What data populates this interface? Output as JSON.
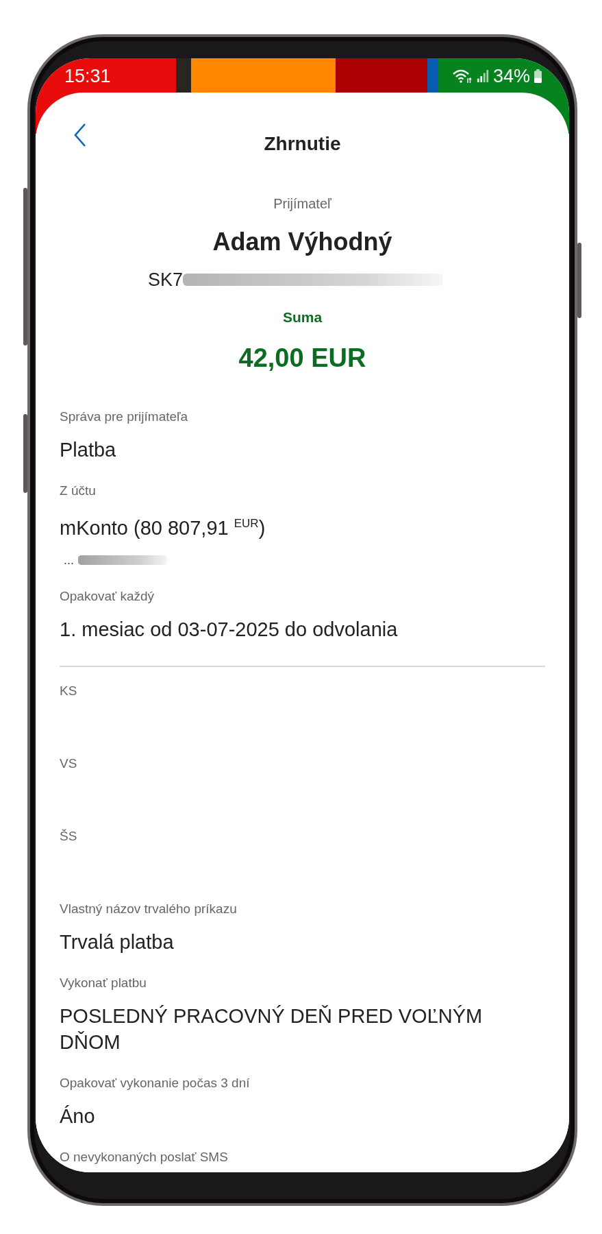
{
  "status_bar": {
    "time": "15:31",
    "battery": "34%"
  },
  "header": {
    "title": "Zhrnutie"
  },
  "recipient": {
    "label": "Prijímateľ",
    "name": "Adam Výhodný",
    "iban": "SK7"
  },
  "amount": {
    "label": "Suma",
    "value": "42,00 EUR"
  },
  "details": [
    {
      "kind": "text",
      "label": "Správa pre prijímateľa",
      "value": "Platba"
    },
    {
      "kind": "account",
      "label": "Z účtu",
      "value": "mKonto (80 807,91 $^{EUR}$)",
      "number": "..."
    },
    {
      "kind": "text",
      "label": "Opakovať každý",
      "value": "1. mesiac od 03-07-2025 do odvolania"
    }
  ],
  "symbols": [
    {
      "label": "KS"
    },
    {
      "label": "VS"
    },
    {
      "label": "ŠS"
    }
  ],
  "settings": [
    {
      "label": "Vlastný názov trvalého príkazu",
      "value": "Trvalá platba"
    },
    {
      "label": "Vykonať platbu",
      "value": "POSLEDNÝ PRACOVNÝ DEŇ PRED VOĽNÝM DŇOM"
    },
    {
      "label": "Opakovať vykonanie počas 3 dní",
      "value": "Áno"
    },
    {
      "label": "O nevykonaných poslať SMS"
    }
  ]
}
